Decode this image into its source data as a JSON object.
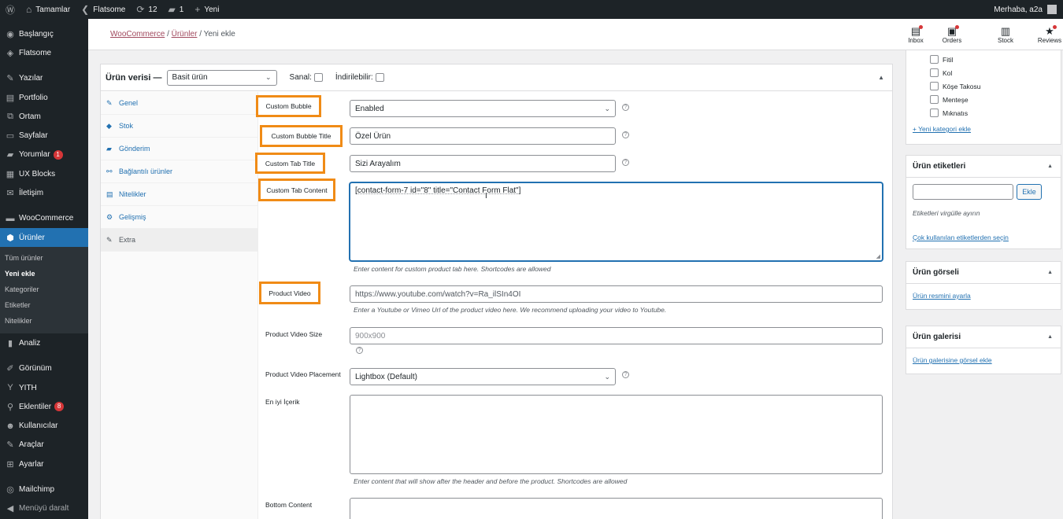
{
  "adminbar": {
    "site_name": "Tamamlar",
    "theme": "Flatsome",
    "updates_count": "12",
    "comments_count": "1",
    "new_label": "Yeni",
    "greeting": "Merhaba, a2a"
  },
  "sidebar": {
    "items": [
      {
        "label": "Başlangıç",
        "icon": "dashboard-icon"
      },
      {
        "label": "Flatsome",
        "icon": "flatsome-icon"
      },
      {
        "label": "Yazılar",
        "icon": "pin-icon"
      },
      {
        "label": "Portfolio",
        "icon": "portfolio-icon"
      },
      {
        "label": "Ortam",
        "icon": "media-icon"
      },
      {
        "label": "Sayfalar",
        "icon": "pages-icon"
      },
      {
        "label": "Yorumlar",
        "icon": "comments-icon",
        "badge": "1"
      },
      {
        "label": "UX Blocks",
        "icon": "blocks-icon"
      },
      {
        "label": "İletişim",
        "icon": "mail-icon"
      },
      {
        "label": "WooCommerce",
        "icon": "woo-icon"
      },
      {
        "label": "Ürünler",
        "icon": "products-icon"
      }
    ],
    "submenu": [
      "Tüm ürünler",
      "Yeni ekle",
      "Kategoriler",
      "Etiketler",
      "Nitelikler"
    ],
    "items_bottom": [
      {
        "label": "Analiz",
        "icon": "analytics-icon"
      },
      {
        "label": "Görünüm",
        "icon": "appearance-icon"
      },
      {
        "label": "YITH",
        "icon": "yith-icon"
      },
      {
        "label": "Eklentiler",
        "icon": "plugins-icon",
        "badge": "8"
      },
      {
        "label": "Kullanıcılar",
        "icon": "users-icon"
      },
      {
        "label": "Araçlar",
        "icon": "tools-icon"
      },
      {
        "label": "Ayarlar",
        "icon": "settings-icon"
      },
      {
        "label": "Mailchimp",
        "icon": "mailchimp-icon"
      },
      {
        "label": "Menüyü daralt",
        "icon": "collapse-icon"
      }
    ]
  },
  "header": {
    "breadcrumb": [
      "WooCommerce",
      "Ürünler",
      "Yeni ekle"
    ],
    "toolbar": [
      {
        "label": "Inbox",
        "icon": "inbox-icon"
      },
      {
        "label": "Orders",
        "icon": "orders-icon"
      },
      {
        "label": "Stock",
        "icon": "stock-icon"
      },
      {
        "label": "Reviews",
        "icon": "star-icon"
      }
    ]
  },
  "product_data": {
    "title": "Ürün verisi —",
    "type_value": "Basit ürün",
    "virtual_label": "Sanal:",
    "downloadable_label": "İndirilebilir:",
    "tabs": [
      {
        "label": "Genel",
        "icon": "wrench-icon"
      },
      {
        "label": "Stok",
        "icon": "stock-icon"
      },
      {
        "label": "Gönderim",
        "icon": "truck-icon"
      },
      {
        "label": "Bağlantılı ürünler",
        "icon": "link-icon"
      },
      {
        "label": "Nitelikler",
        "icon": "list-icon"
      },
      {
        "label": "Gelişmiş",
        "icon": "gear-icon"
      },
      {
        "label": "Extra",
        "icon": "wrench-icon"
      }
    ],
    "fields": {
      "custom_bubble": {
        "label": "Custom Bubble",
        "value": "Enabled"
      },
      "custom_bubble_title": {
        "label": "Custom Bubble Title",
        "value": "Özel Ürün"
      },
      "custom_tab_title": {
        "label": "Custom Tab Title",
        "value": "Sizi Arayalım"
      },
      "custom_tab_content": {
        "label": "Custom Tab Content",
        "value": "[contact-form-7 id=\"8\" title=\"Contact Form Flat\"]",
        "description": "Enter content for custom product tab here. Shortcodes are allowed"
      },
      "product_video": {
        "label": "Product Video",
        "value": "https://www.youtube.com/watch?v=Ra_ilSIn4OI",
        "description": "Enter a Youtube or Vimeo Url of the product video here. We recommend uploading your video to Youtube."
      },
      "product_video_size": {
        "label": "Product Video Size",
        "placeholder": "900x900"
      },
      "product_video_placement": {
        "label": "Product Video Placement",
        "value": "Lightbox (Default)"
      },
      "top_content": {
        "label": "En iyi İçerik",
        "value": "",
        "description": "Enter content that will show after the header and before the product. Shortcodes are allowed"
      },
      "bottom_content": {
        "label": "Bottom Content",
        "value": ""
      }
    }
  },
  "right": {
    "categories": [
      "Fitil",
      "Kol",
      "Köşe Takosu",
      "Menteşe",
      "Mıknatıs"
    ],
    "add_category": "+ Yeni kategori ekle",
    "tags": {
      "title": "Ürün etiketleri",
      "button": "Ekle",
      "hint": "Etiketleri virgülle ayırın",
      "popular_link": "Çok kullanılan etiketlerden seçin"
    },
    "image": {
      "title": "Ürün görseli",
      "link": "Ürün resmini ayarla"
    },
    "gallery": {
      "title": "Ürün galerisi",
      "link": "Ürün galerisine görsel ekle"
    }
  },
  "colors": {
    "highlight": "#f08b16",
    "sidebar_active": "#2271b1",
    "admin_bg": "#1d2327"
  }
}
